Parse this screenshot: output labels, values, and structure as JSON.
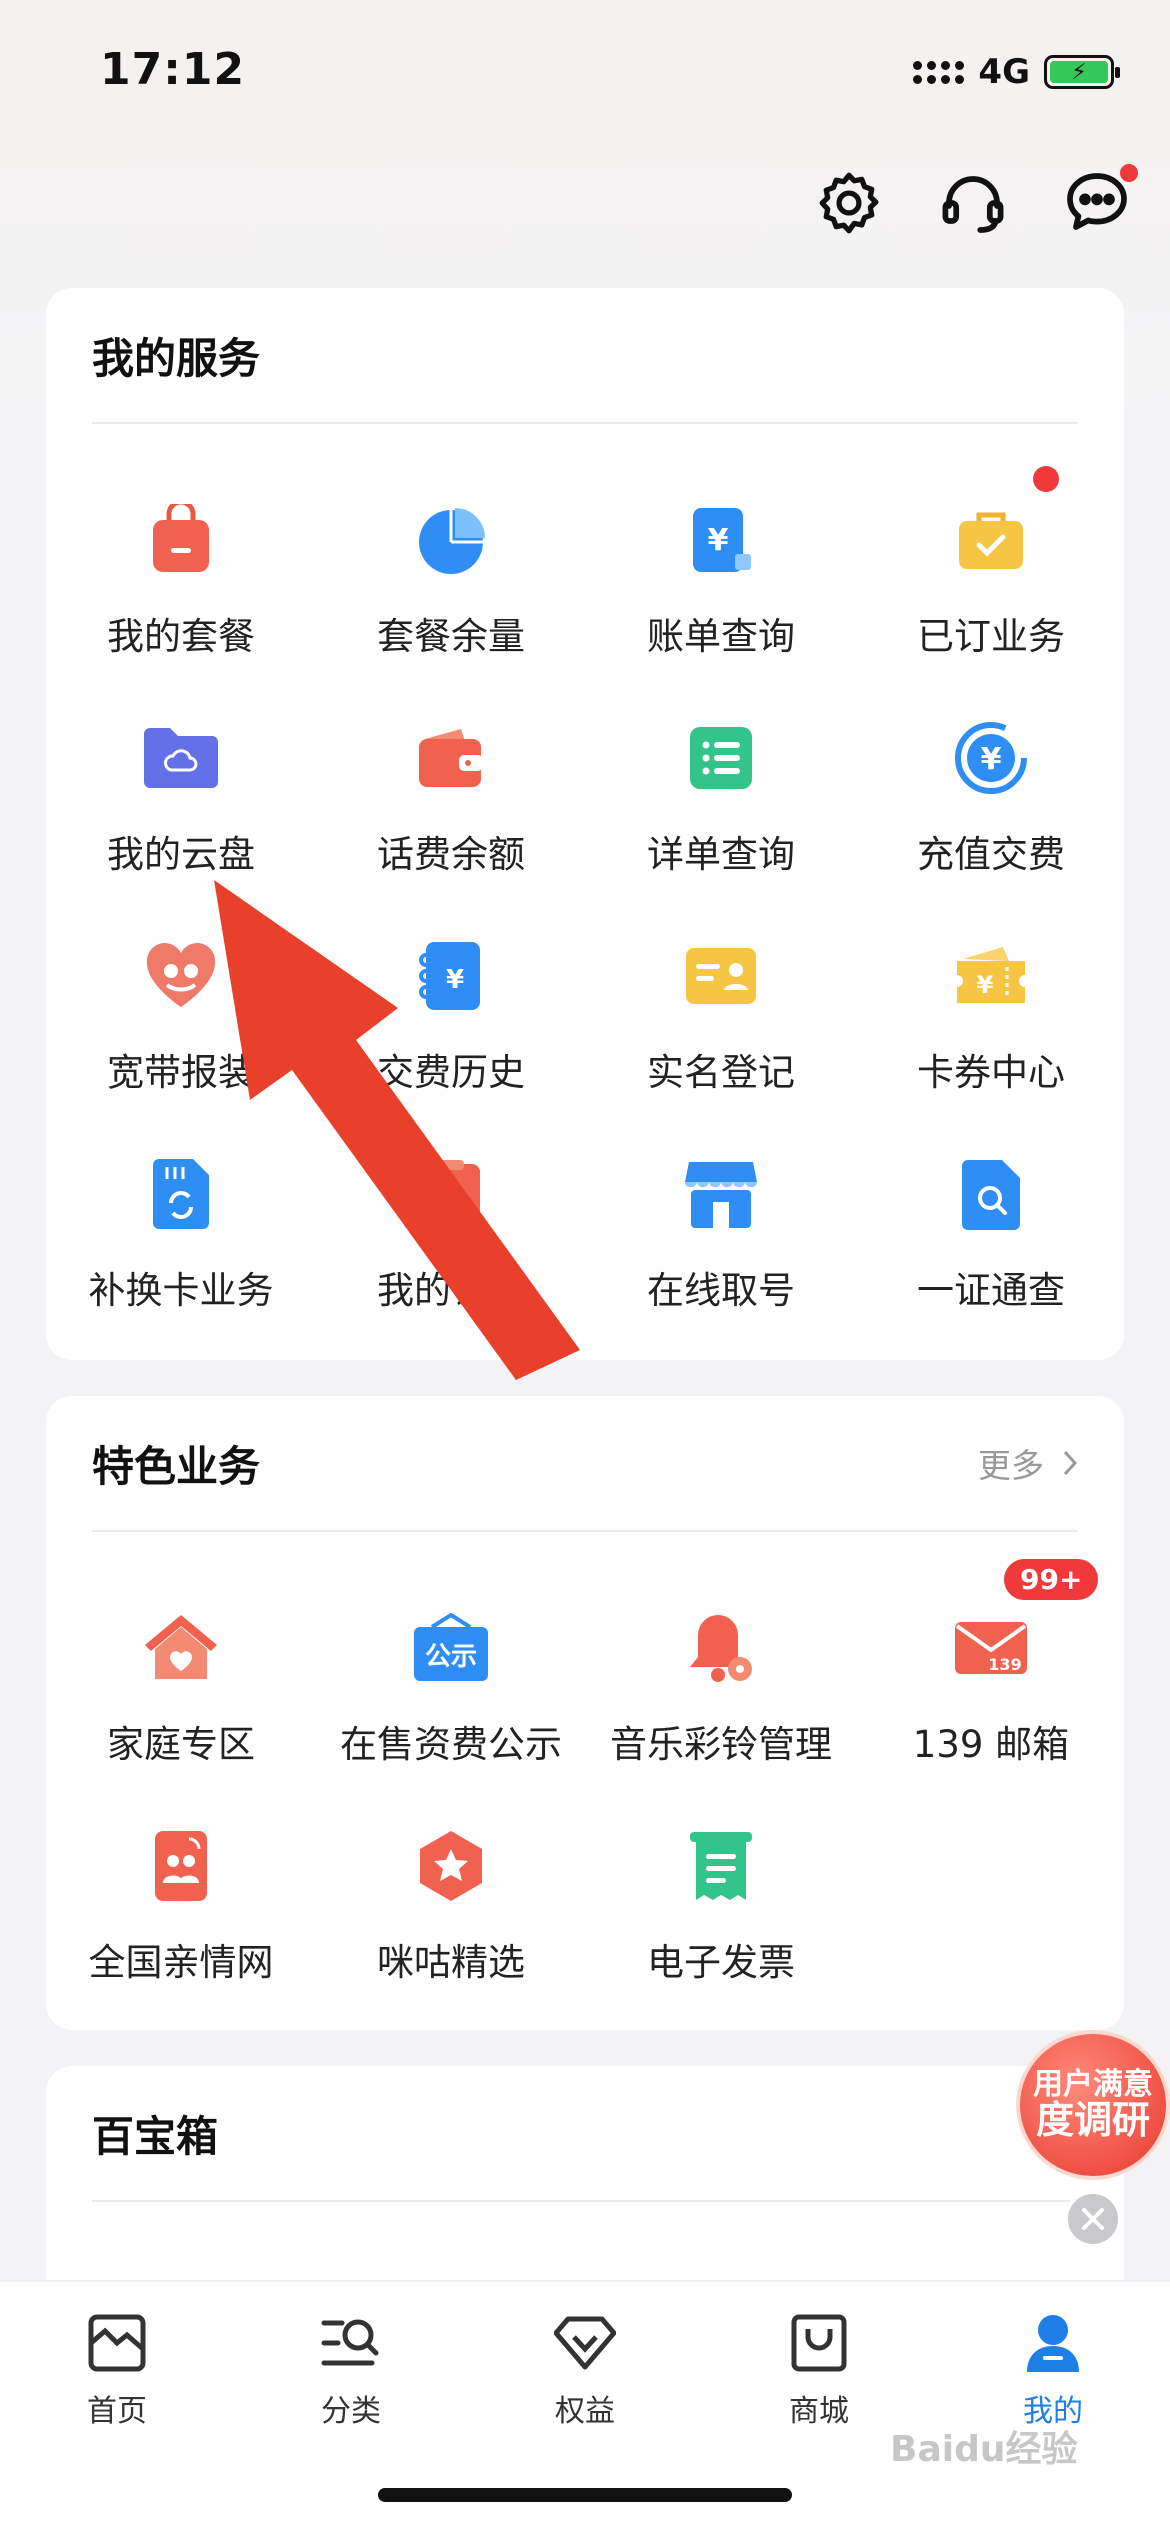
{
  "status_bar": {
    "time": "17:12",
    "network": "4G"
  },
  "services": {
    "title": "我的服务",
    "items": [
      {
        "label": "我的套餐",
        "icon": "bag-icon"
      },
      {
        "label": "套餐余量",
        "icon": "pie-chart-icon"
      },
      {
        "label": "账单查询",
        "icon": "bill-icon"
      },
      {
        "label": "已订业务",
        "icon": "briefcase-icon"
      },
      {
        "label": "我的云盘",
        "icon": "cloud-folder-icon"
      },
      {
        "label": "话费余额",
        "icon": "wallet-icon"
      },
      {
        "label": "详单查询",
        "icon": "list-icon"
      },
      {
        "label": "充值交费",
        "icon": "yuan-recharge-icon"
      },
      {
        "label": "宽带报装",
        "icon": "heart-icon"
      },
      {
        "label": "交费历史",
        "icon": "payment-book-icon"
      },
      {
        "label": "实名登记",
        "icon": "id-card-icon"
      },
      {
        "label": "卡券中心",
        "icon": "coupon-icon"
      },
      {
        "label": "补换卡业务",
        "icon": "sim-card-icon"
      },
      {
        "label": "我的订单",
        "icon": "order-icon"
      },
      {
        "label": "在线取号",
        "icon": "store-icon"
      },
      {
        "label": "一证通查",
        "icon": "document-search-icon"
      }
    ]
  },
  "featured": {
    "title": "特色业务",
    "more": "更多",
    "items": [
      {
        "label": "家庭专区",
        "icon": "home-heart-icon"
      },
      {
        "label": "在售资费公示",
        "icon": "notice-board-icon",
        "text": "公示"
      },
      {
        "label": "音乐彩铃管理",
        "icon": "bell-icon"
      },
      {
        "label": "139 邮箱",
        "icon": "mail-icon",
        "badge": "99+",
        "text": "139"
      },
      {
        "label": "全国亲情网",
        "icon": "family-phone-icon"
      },
      {
        "label": "咪咕精选",
        "icon": "star-hexagon-icon"
      },
      {
        "label": "电子发票",
        "icon": "invoice-icon"
      }
    ]
  },
  "treasure": {
    "title": "百宝箱"
  },
  "survey": {
    "line1": "用户满意",
    "line2": "度调研"
  },
  "nav": [
    {
      "label": "首页",
      "icon": "home-icon"
    },
    {
      "label": "分类",
      "icon": "category-search-icon"
    },
    {
      "label": "权益",
      "icon": "diamond-icon"
    },
    {
      "label": "商城",
      "icon": "shopping-bag-icon"
    },
    {
      "label": "我的",
      "icon": "user-icon"
    }
  ],
  "watermark": "Baidu经验",
  "colors": {
    "accent": "#1e7fe6",
    "alert": "#f0393a",
    "annotation_arrow": "#e8402a"
  }
}
